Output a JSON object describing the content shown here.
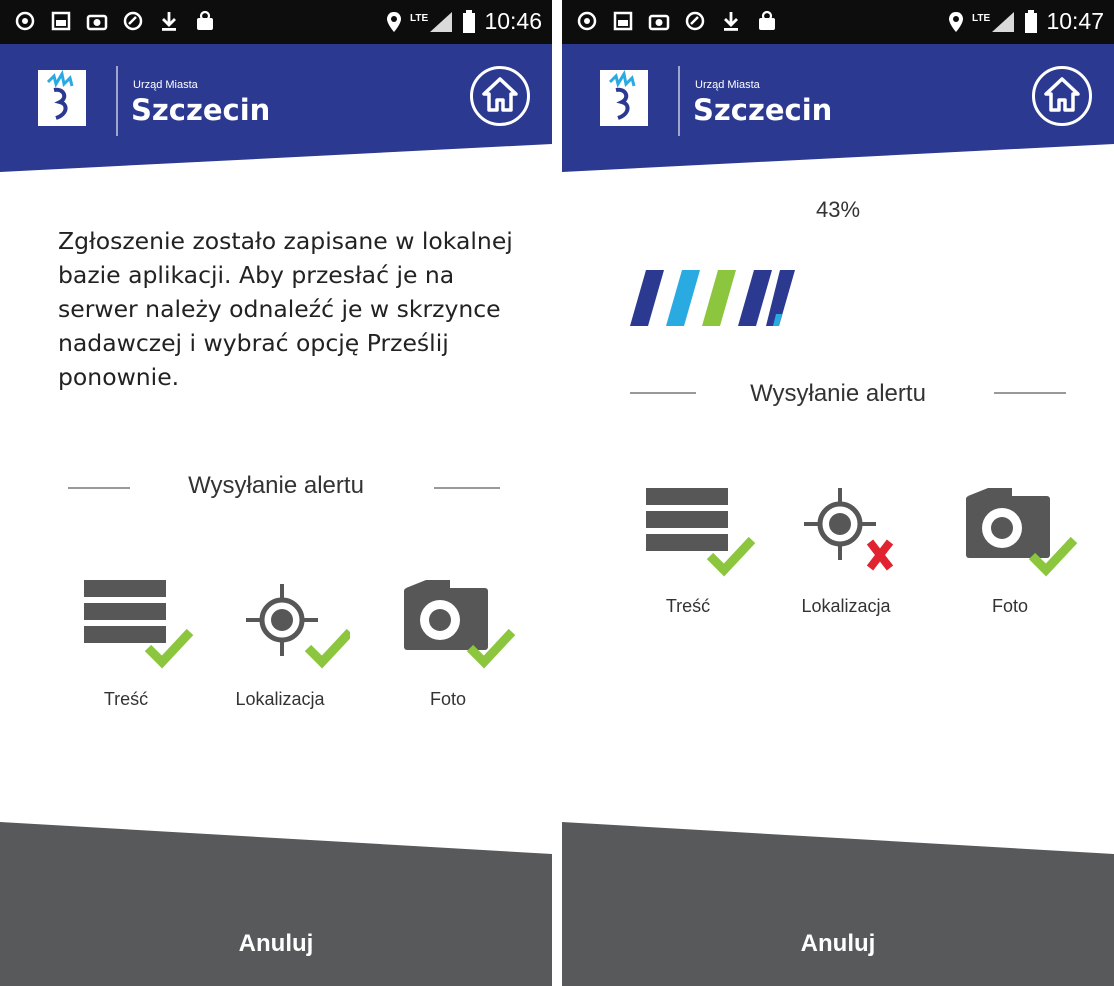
{
  "colors": {
    "header_blue": "#2b3990",
    "footer_gray": "#58595b",
    "check_green": "#8cc63f",
    "error_red": "#e0232f",
    "stripe_navy": "#2b3990",
    "stripe_cyan": "#29abe2",
    "stripe_green": "#8cc63f"
  },
  "screens": [
    {
      "statusbar": {
        "time": "10:46",
        "icons": [
          "settings-icon",
          "image-icon",
          "camera-icon",
          "sync-icon",
          "download-icon",
          "bag-icon"
        ],
        "right_icons": [
          "location-icon",
          "lte-signal-icon",
          "battery-icon"
        ]
      },
      "header": {
        "city_small": "Urząd Miasta",
        "city_name": "Szczecin",
        "home_icon": "home-icon"
      },
      "message": "Zgłoszenie zostało zapisane w lokalnej bazie aplikacji. Aby przesłać je na serwer należy odnaleźć je w skrzynce nadawczej i wybrać opcję Prześlij ponownie.",
      "section_title": "Wysyłanie alertu",
      "status_items": [
        {
          "label": "Treść",
          "icon": "list-icon",
          "status": "success"
        },
        {
          "label": "Lokalizacja",
          "icon": "crosshair-icon",
          "status": "success"
        },
        {
          "label": "Foto",
          "icon": "camera-icon",
          "status": "success"
        }
      ],
      "cancel_label": "Anuluj"
    },
    {
      "statusbar": {
        "time": "10:47",
        "icons": [
          "settings-icon",
          "image-icon",
          "camera-icon",
          "sync-icon",
          "download-icon",
          "bag-icon"
        ],
        "right_icons": [
          "location-icon",
          "lte-signal-icon",
          "battery-icon"
        ]
      },
      "header": {
        "city_small": "Urząd Miasta",
        "city_name": "Szczecin",
        "home_icon": "home-icon"
      },
      "progress_percent": "43%",
      "section_title": "Wysyłanie alertu",
      "status_items": [
        {
          "label": "Treść",
          "icon": "list-icon",
          "status": "success"
        },
        {
          "label": "Lokalizacja",
          "icon": "crosshair-icon",
          "status": "error"
        },
        {
          "label": "Foto",
          "icon": "camera-icon",
          "status": "success"
        }
      ],
      "cancel_label": "Anuluj"
    }
  ]
}
